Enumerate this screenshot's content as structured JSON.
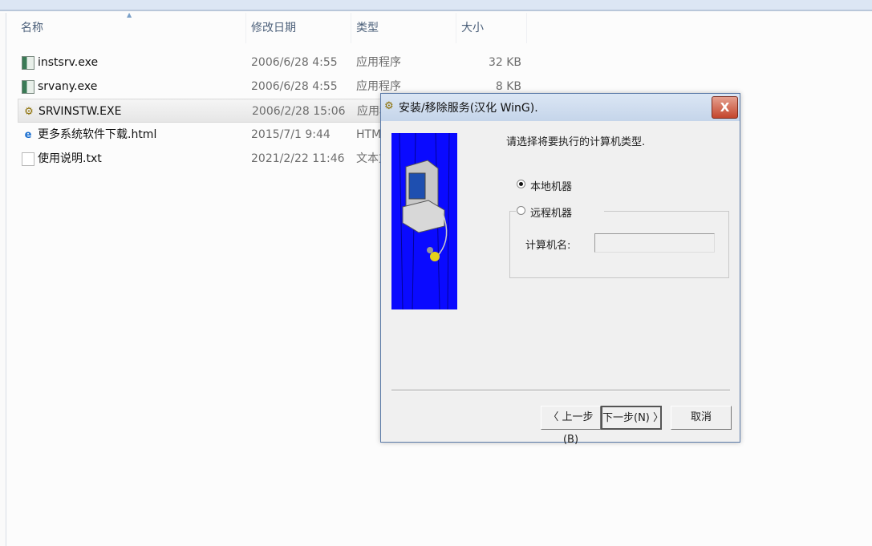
{
  "explorer": {
    "columns": {
      "name": "名称",
      "date": "修改日期",
      "type": "类型",
      "size": "大小"
    },
    "files": [
      {
        "name": "instsrv.exe",
        "date": "2006/6/28 4:55",
        "type": "应用程序",
        "size": "32 KB",
        "icon": "exe-icon"
      },
      {
        "name": "srvany.exe",
        "date": "2006/6/28 4:55",
        "type": "应用程序",
        "size": "8 KB",
        "icon": "exe-icon"
      },
      {
        "name": "SRVINSTW.EXE",
        "date": "2006/2/28 15:06",
        "type": "应用程序",
        "size": "",
        "icon": "gear-app-icon",
        "selected": true
      },
      {
        "name": "更多系统软件下载.html",
        "date": "2015/7/1 9:44",
        "type": "HTML",
        "size": "",
        "icon": "ie-html-icon"
      },
      {
        "name": "使用说明.txt",
        "date": "2021/2/22 11:46",
        "type": "文本文",
        "size": "",
        "icon": "text-file-icon"
      }
    ]
  },
  "dialog": {
    "title": "安装/移除服务(汉化 WinG).",
    "close_label": "X",
    "prompt": "请选择将要执行的计算机类型.",
    "radio_local": "本地机器",
    "radio_remote": "远程机器",
    "selected": "local",
    "computer_name_label": "计算机名:",
    "computer_name_value": "",
    "back_label": "〈 上一步(B)",
    "next_label": "下一步(N) 〉",
    "cancel_label": "取消"
  }
}
